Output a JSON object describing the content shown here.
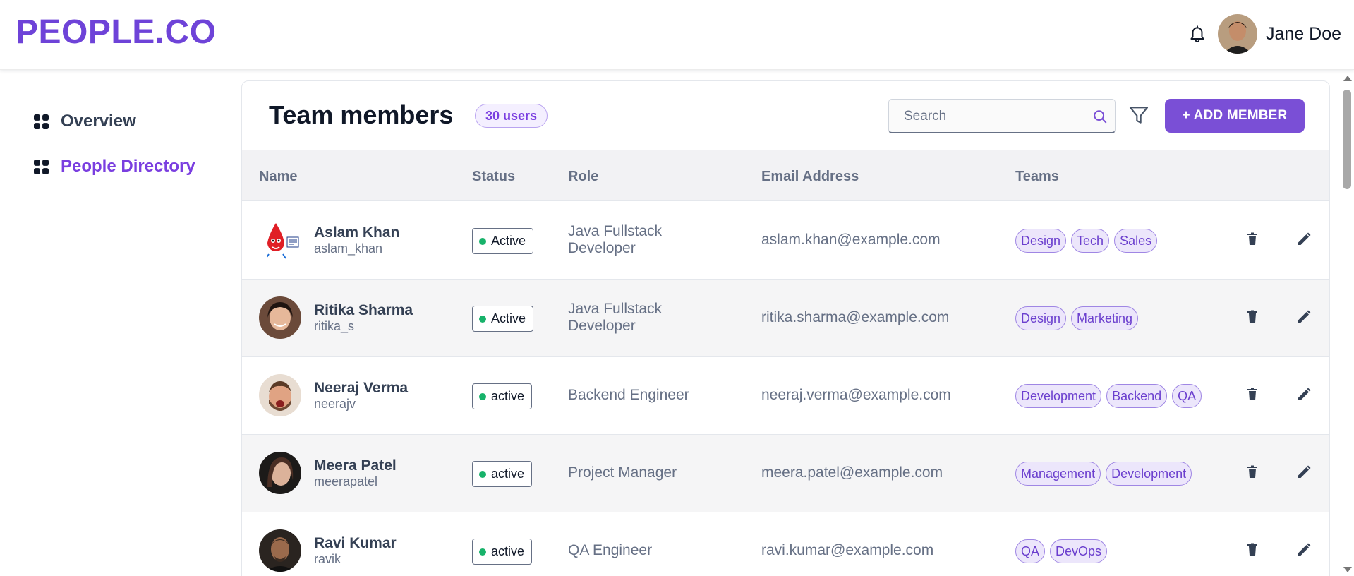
{
  "header": {
    "logo": "PEOPLE.CO",
    "user_name": "Jane Doe"
  },
  "sidebar": {
    "items": [
      {
        "label": "Overview",
        "active": false
      },
      {
        "label": "People Directory",
        "active": true
      }
    ]
  },
  "main": {
    "title": "Team members",
    "users_badge": "30 users",
    "search_placeholder": "Search",
    "search_value": "",
    "add_button": "+ ADD MEMBER",
    "columns": [
      "Name",
      "Status",
      "Role",
      "Email Address",
      "Teams"
    ],
    "rows": [
      {
        "name": "Aslam Khan",
        "handle": "aslam_khan",
        "status": "Active",
        "role_line1": "Java Fullstack",
        "role_line2": "Developer",
        "email": "aslam.khan@example.com",
        "teams": [
          "Design",
          "Tech",
          "Sales"
        ]
      },
      {
        "name": "Ritika Sharma",
        "handle": "ritika_s",
        "status": "Active",
        "role_line1": "Java Fullstack",
        "role_line2": "Developer",
        "email": "ritika.sharma@example.com",
        "teams": [
          "Design",
          "Marketing"
        ]
      },
      {
        "name": "Neeraj Verma",
        "handle": "neerajv",
        "status": "active",
        "role_line1": "Backend Engineer",
        "role_line2": "",
        "email": "neeraj.verma@example.com",
        "teams": [
          "Development",
          "Backend",
          "QA"
        ]
      },
      {
        "name": "Meera Patel",
        "handle": "meerapatel",
        "status": "active",
        "role_line1": "Project Manager",
        "role_line2": "",
        "email": "meera.patel@example.com",
        "teams": [
          "Management",
          "Development"
        ]
      },
      {
        "name": "Ravi Kumar",
        "handle": "ravik",
        "status": "active",
        "role_line1": "QA Engineer",
        "role_line2": "",
        "email": "ravi.kumar@example.com",
        "teams": [
          "QA",
          "DevOps"
        ]
      }
    ]
  },
  "colors": {
    "brand": "#6e43d8",
    "accent": "#7a4fd6",
    "status_active": "#17b26a",
    "tag_bg": "#ece6fb",
    "tag_text": "#6b3fce"
  },
  "icons": {
    "notification": "bell-icon",
    "search": "search-icon",
    "filter": "filter-icon",
    "delete": "trash-icon",
    "edit": "pencil-icon",
    "nav": "grid-icon"
  }
}
